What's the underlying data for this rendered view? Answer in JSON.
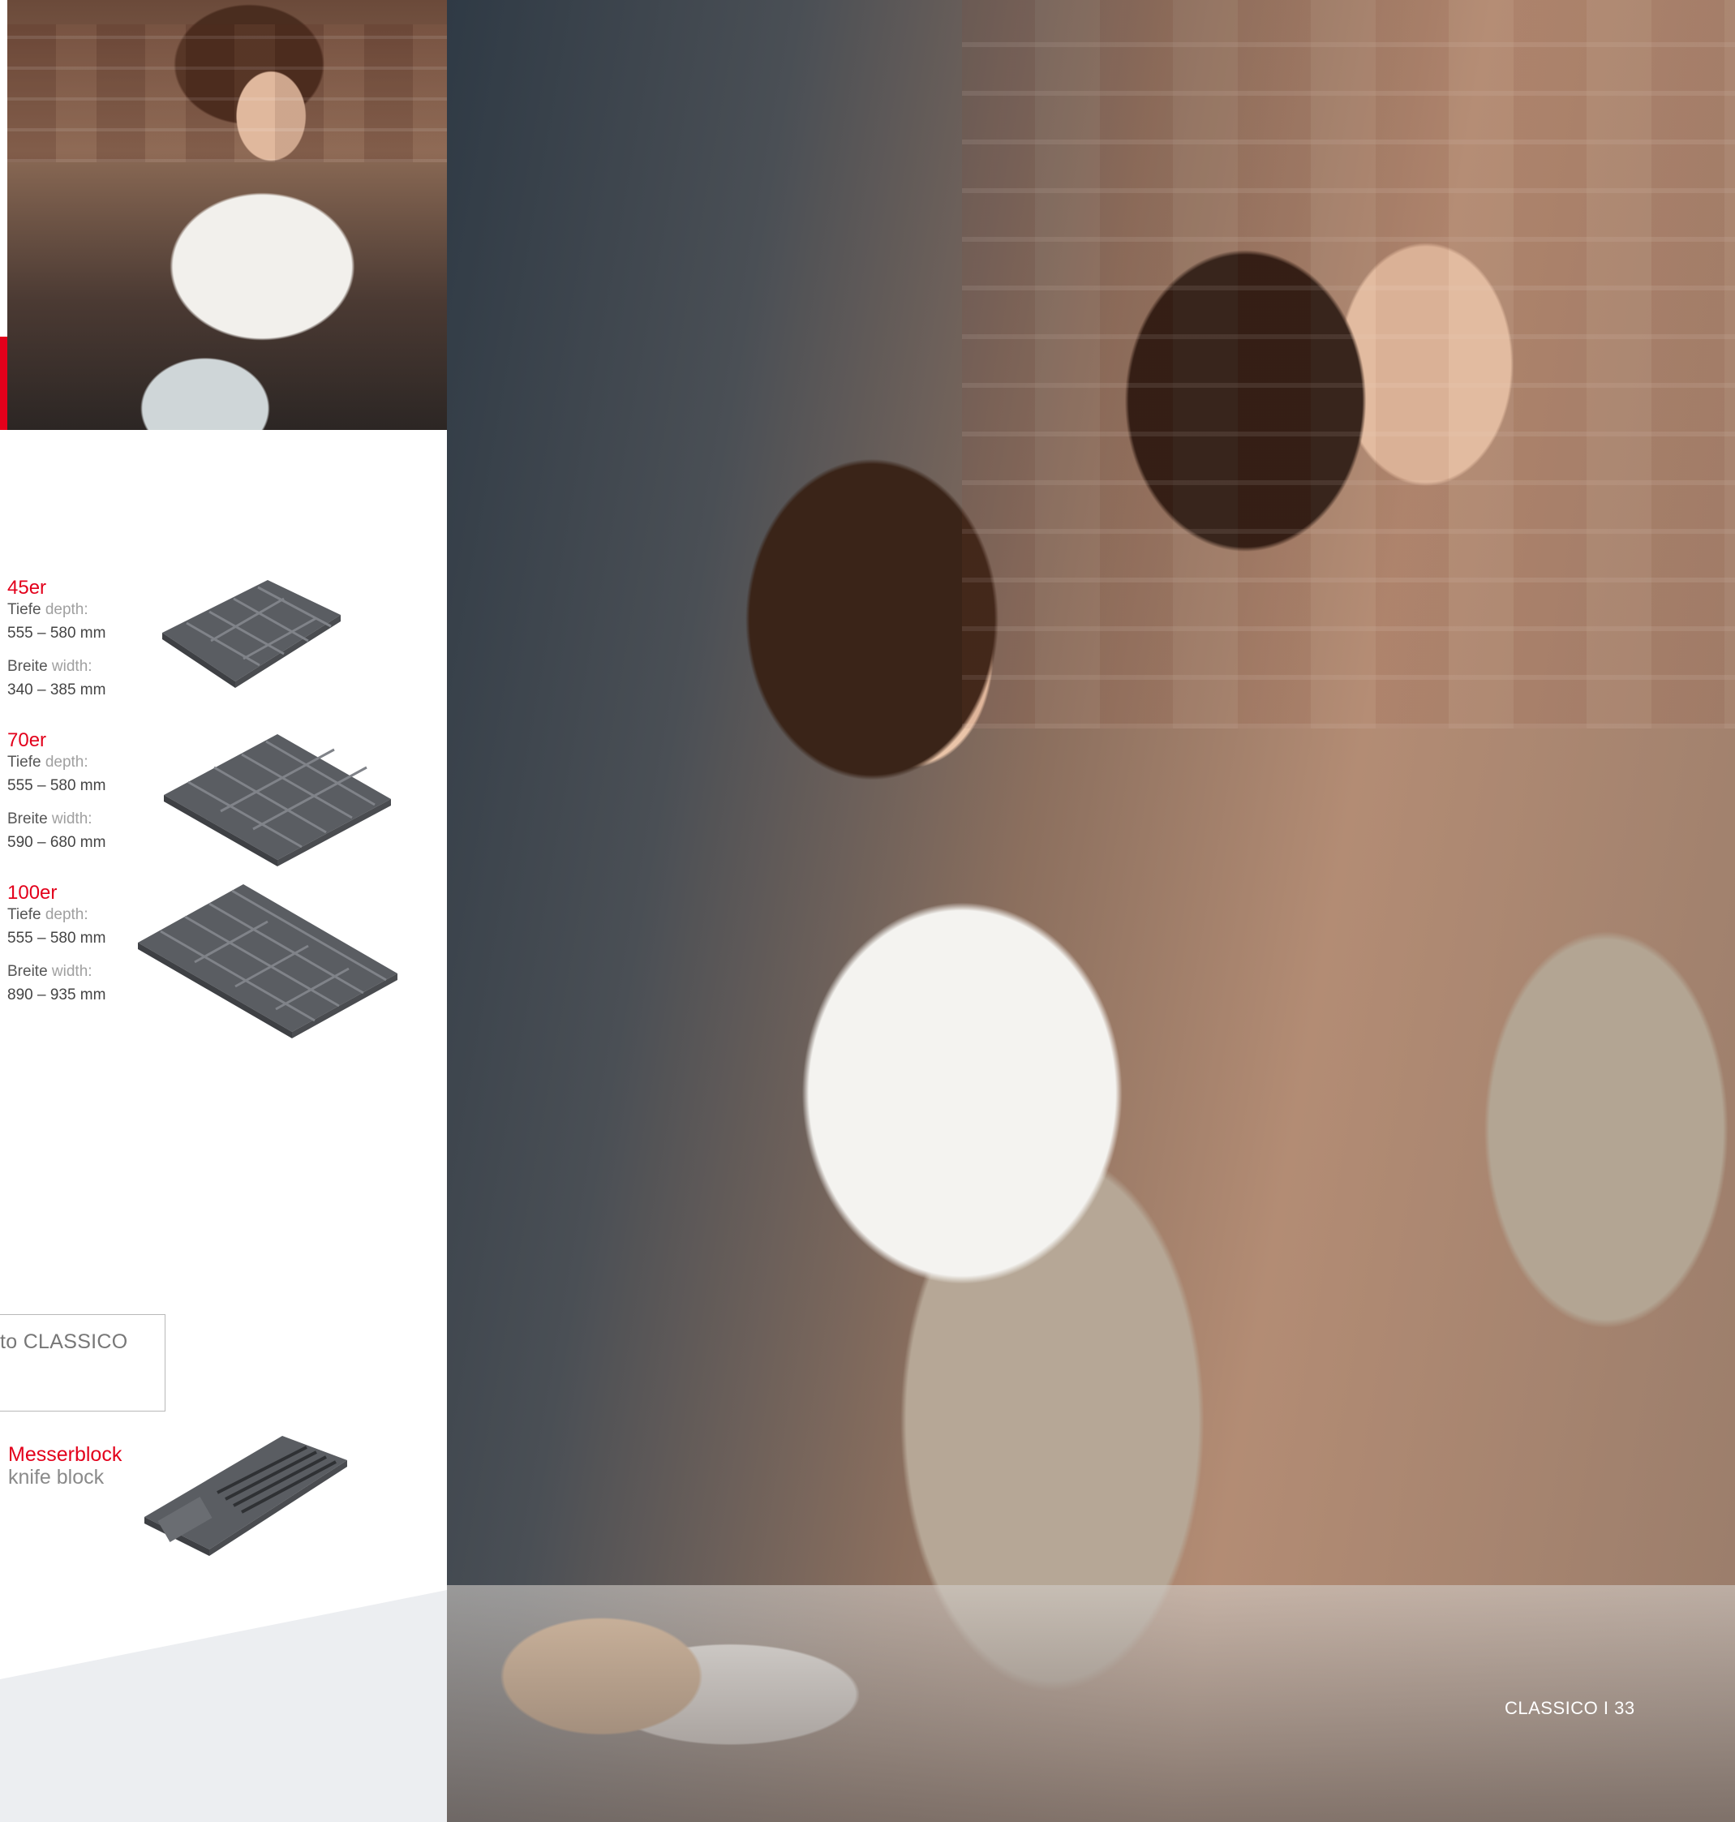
{
  "products": [
    {
      "name": "45er",
      "depth_label_de": "Tiefe",
      "depth_label_en": "depth:",
      "depth_value": "555 – 580 mm",
      "width_label_de": "Breite",
      "width_label_en": "width:",
      "width_value": "340 – 385 mm"
    },
    {
      "name": "70er",
      "depth_label_de": "Tiefe",
      "depth_label_en": "depth:",
      "depth_value": "555 – 580 mm",
      "width_label_de": "Breite",
      "width_label_en": "width:",
      "width_value": "590 – 680 mm"
    },
    {
      "name": "100er",
      "depth_label_de": "Tiefe",
      "depth_label_en": "depth:",
      "depth_value": "555 – 580 mm",
      "width_label_de": "Breite",
      "width_label_en": "width:",
      "width_value": "890 – 935 mm"
    }
  ],
  "hint_box_text": "to CLASSICO",
  "accessory": {
    "name_de": "Messerblock",
    "name_en": "knife block"
  },
  "footer": "CLASSICO I 33",
  "colors": {
    "accent": "#e3001b",
    "text_gray": "#555555",
    "light_gray": "#a0a0a0",
    "tray": "#5a5d62"
  }
}
